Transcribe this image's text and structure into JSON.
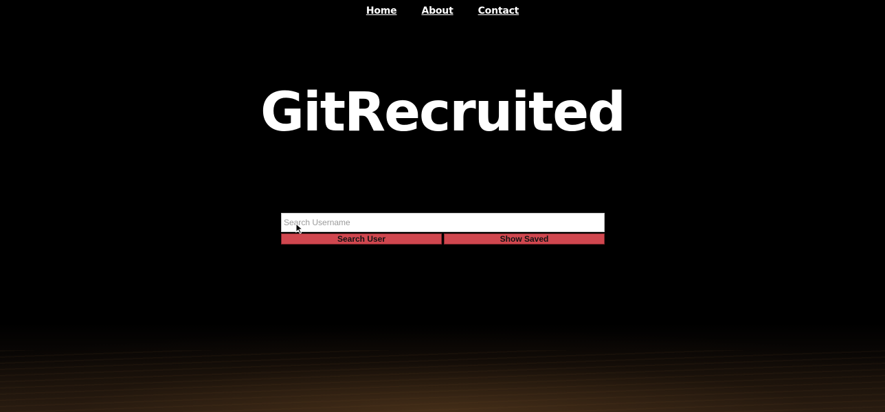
{
  "nav": {
    "items": [
      {
        "label": "Home"
      },
      {
        "label": "About"
      },
      {
        "label": "Contact"
      }
    ]
  },
  "hero": {
    "title": "GitRecruited"
  },
  "search": {
    "placeholder": "Search Username",
    "value": "",
    "search_button_label": "Search User",
    "saved_button_label": "Show Saved"
  },
  "colors": {
    "background": "#000000",
    "button": "#d0474f",
    "text": "#ffffff"
  }
}
